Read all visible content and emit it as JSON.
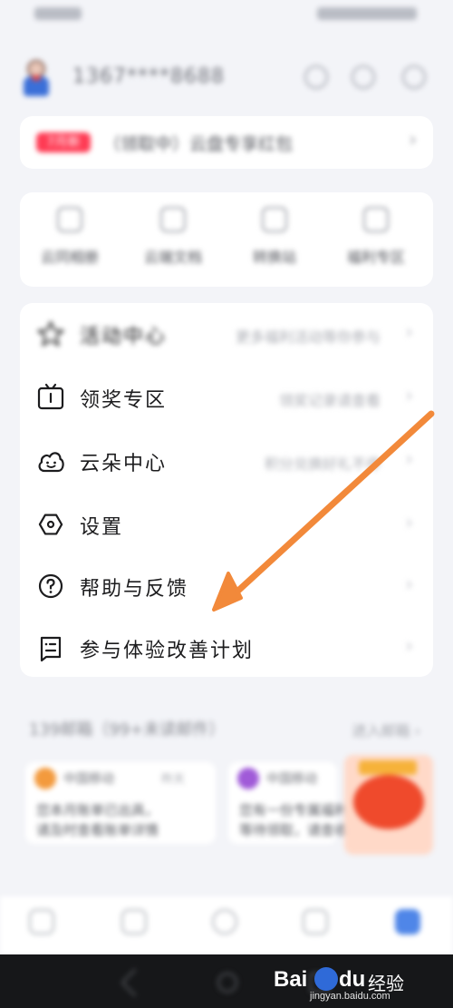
{
  "status_bar": {
    "left": "",
    "right": ""
  },
  "header": {
    "username": "1367****8688"
  },
  "banner": {
    "tag": "7月新",
    "text": "（领取中）云盘专享红包",
    "chevron": "›"
  },
  "quick_links": [
    {
      "label": "云同相册",
      "icon": "album-icon"
    },
    {
      "label": "云端文档",
      "icon": "doc-icon"
    },
    {
      "label": "转换站",
      "icon": "convert-icon"
    },
    {
      "label": "福利专区",
      "icon": "gift-icon"
    }
  ],
  "menu": {
    "items": [
      {
        "label": "活动中心",
        "value": "更多福利活动等你参与",
        "icon": "star-icon"
      },
      {
        "label": "领奖专区",
        "value": "领奖记录请查看",
        "icon": "tv-icon"
      },
      {
        "label": "云朵中心",
        "value": "积分兑换好礼不停",
        "icon": "cloud-smile-icon"
      },
      {
        "label": "设置",
        "value": "",
        "icon": "settings-hex-icon"
      },
      {
        "label": "帮助与反馈",
        "value": "",
        "icon": "question-circle-icon"
      },
      {
        "label": "参与体验改善计划",
        "value": "",
        "icon": "feedback-form-icon"
      }
    ],
    "chevron": "›"
  },
  "mail": {
    "title": "139邮箱（99+未读邮件）",
    "more": "进入邮箱 ›",
    "messages": [
      {
        "sender": "中国移动",
        "time": "昨天",
        "lines": [
          "您本月账单已出具，",
          "请及时查看账单详情"
        ],
        "color": "#f39a3d"
      },
      {
        "sender": "中国移动",
        "time": "",
        "lines": [
          "您有一份专属福利",
          "等待领取，请查收"
        ],
        "color": "#a05ad8"
      }
    ]
  },
  "watermark": {
    "brand": "Bai",
    "brand_suffix": "du",
    "cn": "经验",
    "site": "jingyan.baidu.com"
  }
}
